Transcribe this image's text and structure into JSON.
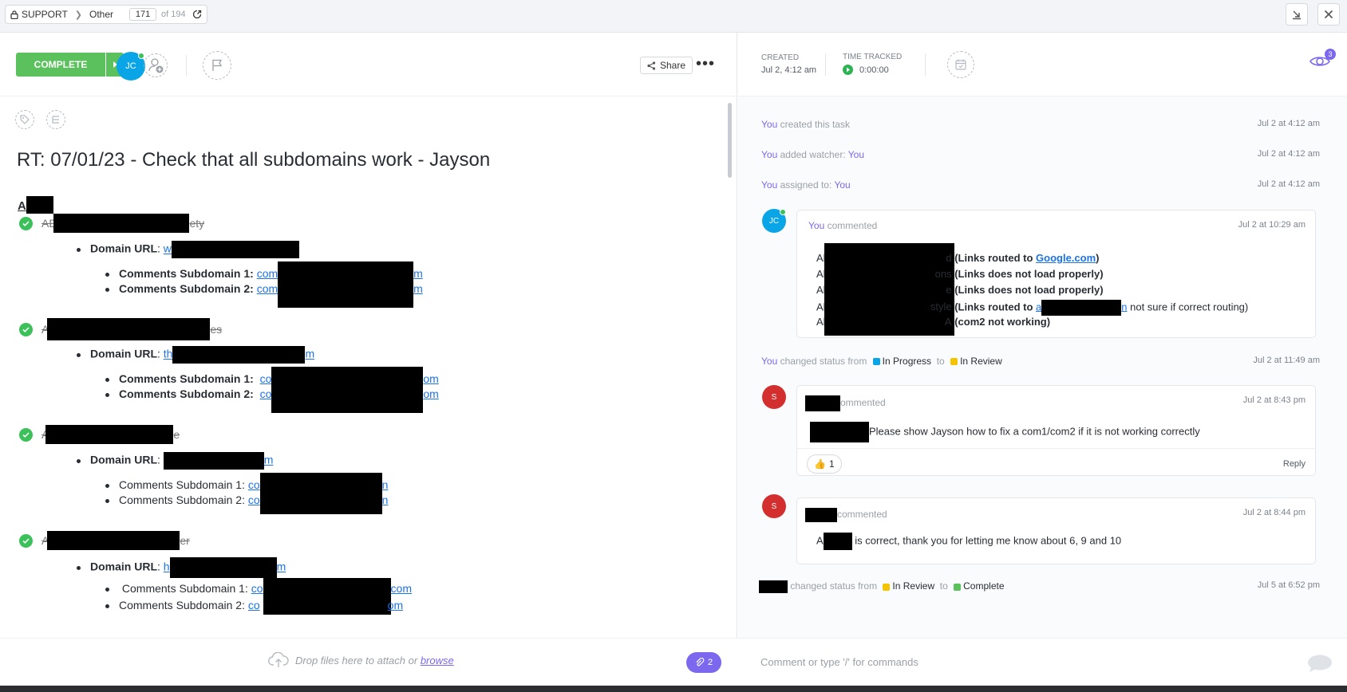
{
  "breadcrumb": {
    "space": "SUPPORT",
    "list": "Other",
    "page": "171",
    "of": "of 194"
  },
  "toolbar": {
    "complete_label": "COMPLETE",
    "avatar_initials": "JC",
    "share_label": "Share"
  },
  "task": {
    "title": "RT: 07/01/23 - Check that all subdomains work - Jayson",
    "section_prefix": "A",
    "entries": [
      {
        "head_prefix": "AD",
        "head_suffix": "ety",
        "domain_label": "Domain URL",
        "domain_prefix": "w",
        "domain_suffix": "",
        "c1_label": "Comments Subdomain 1:",
        "c1_prefix": "com",
        "c1_suffix": "m",
        "c2_label": "Comments Subdomain 2:",
        "c2_prefix": "com",
        "c2_suffix": "m"
      },
      {
        "head_prefix": "A",
        "head_suffix": "es",
        "domain_label": "Domain URL",
        "domain_prefix": "th",
        "domain_suffix": "m",
        "c1_label": "Comments Subdomain 1:",
        "c1_prefix": "co",
        "c1_suffix": "om",
        "c2_label": "Comments Subdomain 2:",
        "c2_prefix": "co",
        "c2_suffix": "om"
      },
      {
        "head_prefix": "A",
        "head_suffix": "e",
        "domain_label": "Domain URL",
        "domain_prefix": "",
        "domain_suffix": "m",
        "c1_label": "Comments Subdomain 1:",
        "c1_prefix": "co",
        "c1_suffix": "n",
        "c2_label": "Comments Subdomain 2:",
        "c2_prefix": "co",
        "c2_suffix": "n"
      },
      {
        "head_prefix": "A",
        "head_suffix": "er",
        "domain_label": "Domain URL",
        "domain_prefix": "h",
        "domain_suffix": "m",
        "c1_label": "Comments Subdomain 1:",
        "c1_prefix": "co",
        "c1_suffix": "com",
        "c2_label": "Comments Subdomain 2:",
        "c2_prefix": "co",
        "c2_suffix": "om"
      }
    ]
  },
  "dropzone": {
    "text": "Drop files here to attach or",
    "browse": "browse",
    "attach_count": "2"
  },
  "meta": {
    "created_label": "CREATED",
    "created_value": "Jul 2, 4:12 am",
    "tracked_label": "TIME TRACKED",
    "tracked_value": "0:00:00",
    "watchers": "3"
  },
  "activity": {
    "a1": {
      "you": "You",
      "text": "created this task",
      "when": "Jul 2 at 4:12 am"
    },
    "a2": {
      "you": "You",
      "text": "added watcher:",
      "target": "You",
      "when": "Jul 2 at 4:12 am"
    },
    "a3": {
      "you": "You",
      "text": "assigned to:",
      "target": "You",
      "when": "Jul 2 at 4:12 am"
    },
    "c1": {
      "avatar": "JC",
      "you": "You",
      "verb": "commented",
      "when": "Jul 2 at 10:29 am",
      "lines": [
        {
          "prefix": "Al",
          "mid": "d",
          "bold": "(Links routed to ",
          "link": "Google.com",
          "bold_end": ")"
        },
        {
          "prefix": "Al",
          "mid": "ons ",
          "bold": "(Links does not load properly)"
        },
        {
          "prefix": "Al",
          "mid": "e",
          "bold": "(Links does not load properly)"
        },
        {
          "prefix": "Al",
          "mid": "style",
          "bold": "(Links routed to ",
          "link": "a",
          "link_end": "n",
          "tail": "not sure if correct routing)"
        },
        {
          "prefix": "Al",
          "mid": "A",
          "bold": "(com2 not working)"
        }
      ]
    },
    "s1": {
      "you": "You",
      "text": "changed status from",
      "from": "In Progress",
      "to_word": "to",
      "to": "In Review",
      "when": "Jul 2 at 11:49 am"
    },
    "c2": {
      "avatar": "S",
      "verb": "ommented",
      "when": "Jul 2 at 8:43 pm",
      "body": "Please show Jayson how to fix a com1/com2 if it is not working correctly",
      "reaction": "1",
      "reply": "Reply"
    },
    "c3": {
      "avatar": "S",
      "verb": "commented",
      "when": "Jul 2 at 8:44 pm",
      "body_prefix": "A",
      "body": "is correct, thank you for letting me know about 6, 9 and 10"
    },
    "s2": {
      "text": "changed status from",
      "from": "In Review",
      "to_word": "to",
      "to": "Complete",
      "when": "Jul 5 at 6:52 pm"
    }
  },
  "comment_bar": {
    "placeholder": "Comment or type '/' for commands"
  },
  "colors": {
    "accent": "#7b68ee",
    "complete": "#5bc15c",
    "in_progress": "#0aa5e6",
    "in_review": "#f5c400"
  }
}
